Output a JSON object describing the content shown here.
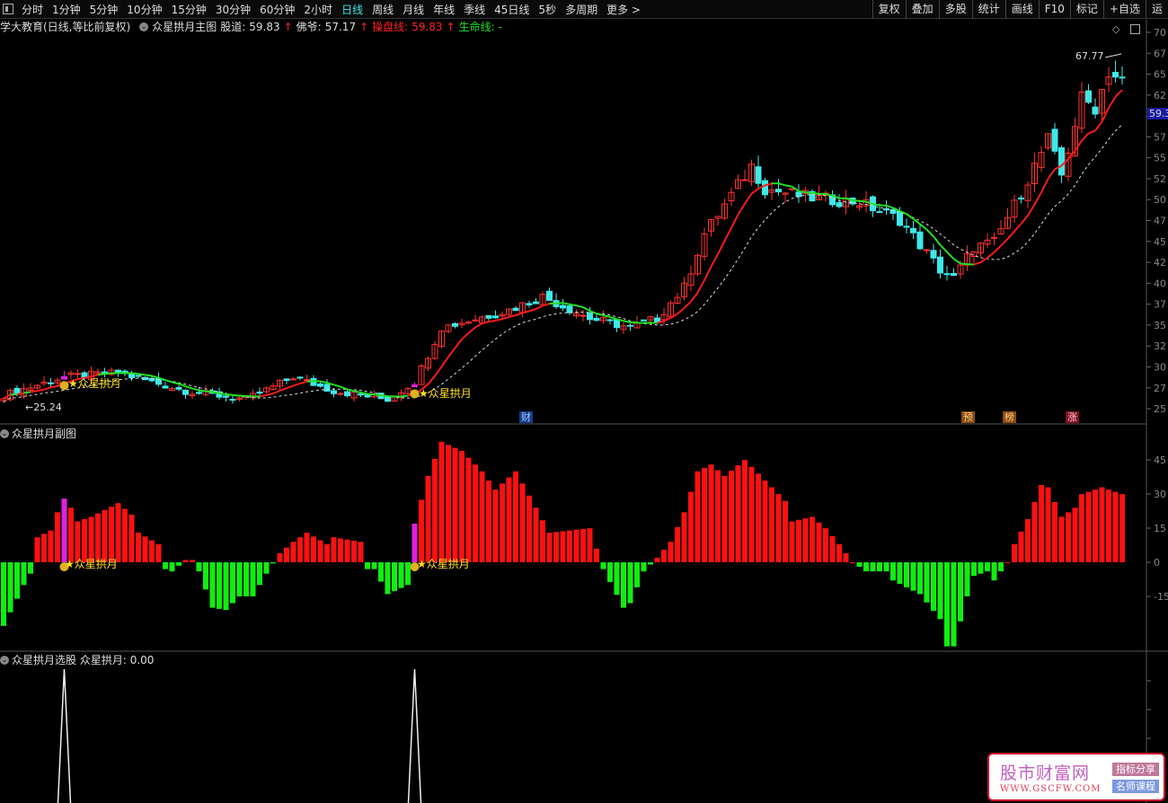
{
  "toolbar": {
    "periods": [
      "分时",
      "1分钟",
      "5分钟",
      "10分钟",
      "15分钟",
      "30分钟",
      "60分钟",
      "2小时",
      "日线",
      "周线",
      "月线",
      "年线",
      "季线",
      "45日线",
      "5秒",
      "多周期",
      "更多 >"
    ],
    "active": "日线",
    "right": [
      "复权",
      "叠加",
      "多股",
      "统计",
      "画线",
      "F10",
      "标记",
      "+自选",
      "运"
    ]
  },
  "header": {
    "stock": "学大教育(日线,等比前复权)",
    "indicator": "众星拱月主图",
    "gudao_label": "股道:",
    "gudao": "59.83",
    "foye_label": "佛爷:",
    "foye": "57.17",
    "caopan_label": "操盘线:",
    "caopan": "59.83",
    "shengming_label": "生命线:",
    "shengming": "-"
  },
  "main": {
    "axis": [
      "70",
      "67",
      "65",
      "62",
      "",
      "57",
      "55",
      "52",
      "50",
      "47",
      "45",
      "42",
      "40",
      "37",
      "35",
      "32",
      "30",
      "27",
      "25"
    ],
    "current_price": "59.3",
    "high_label": "67.77",
    "low_label": "←25.24",
    "signal_label": "★众星拱月",
    "badges": [
      "财",
      "预",
      "榜",
      "涨"
    ],
    "colors": {
      "up": "#ff3030",
      "down": "#3ee8e8",
      "ma_up": "#ff1a1a",
      "ma_flat": "#20e020",
      "signal": "#e020e0"
    },
    "price_keypoints": [
      [
        0,
        26.6
      ],
      [
        9,
        28.8
      ],
      [
        17,
        29.3
      ],
      [
        27,
        27.1
      ],
      [
        36,
        26.1
      ],
      [
        43,
        28.8
      ],
      [
        49,
        27.1
      ],
      [
        57,
        26.1
      ],
      [
        61,
        28.2
      ],
      [
        65,
        34.7
      ],
      [
        75,
        36.8
      ],
      [
        80,
        38.4
      ],
      [
        87,
        35.8
      ],
      [
        93,
        34.7
      ],
      [
        97,
        35.8
      ],
      [
        101,
        39.5
      ],
      [
        104,
        45.9
      ],
      [
        111,
        54.0
      ],
      [
        113,
        51.3
      ],
      [
        120,
        50.2
      ],
      [
        127,
        49.7
      ],
      [
        133,
        47.6
      ],
      [
        139,
        41.6
      ],
      [
        141,
        40.6
      ],
      [
        144,
        44.3
      ],
      [
        147,
        44.9
      ],
      [
        151,
        50.8
      ],
      [
        155,
        57.2
      ],
      [
        157,
        52.9
      ],
      [
        160,
        62.1
      ],
      [
        162,
        61.0
      ],
      [
        164,
        65.3
      ],
      [
        166,
        64.2
      ]
    ],
    "signal_bars": [
      9,
      61
    ]
  },
  "sub": {
    "title": "众星拱月副图",
    "axis": [
      "45",
      "30",
      "15",
      "0",
      "-15"
    ],
    "signal_label": "★众星拱月",
    "hist_keypoints": [
      [
        0,
        -28
      ],
      [
        1,
        -22
      ],
      [
        3,
        -10
      ],
      [
        4,
        -5
      ],
      [
        5,
        11
      ],
      [
        7,
        14
      ],
      [
        8,
        22
      ],
      [
        9,
        28
      ],
      [
        10,
        24
      ],
      [
        11,
        18
      ],
      [
        13,
        20
      ],
      [
        17,
        26
      ],
      [
        19,
        21
      ],
      [
        20,
        13
      ],
      [
        23,
        8
      ],
      [
        24,
        -3
      ],
      [
        25,
        -4
      ],
      [
        27,
        1
      ],
      [
        28,
        1
      ],
      [
        29,
        -4
      ],
      [
        31,
        -20
      ],
      [
        33,
        -21
      ],
      [
        35,
        -15
      ],
      [
        37,
        -15
      ],
      [
        39,
        -5
      ],
      [
        41,
        4
      ],
      [
        43,
        9
      ],
      [
        45,
        13
      ],
      [
        48,
        8
      ],
      [
        49,
        11
      ],
      [
        53,
        9
      ],
      [
        54,
        -3
      ],
      [
        55,
        -3
      ],
      [
        57,
        -14
      ],
      [
        60,
        -10
      ],
      [
        61,
        17
      ],
      [
        63,
        38
      ],
      [
        65,
        53
      ],
      [
        68,
        49
      ],
      [
        71,
        40
      ],
      [
        73,
        32
      ],
      [
        76,
        40
      ],
      [
        79,
        24
      ],
      [
        81,
        13
      ],
      [
        84,
        14
      ],
      [
        87,
        15
      ],
      [
        89,
        -3
      ],
      [
        92,
        -20
      ],
      [
        93,
        -18
      ],
      [
        95,
        -4
      ],
      [
        97,
        2
      ],
      [
        99,
        9
      ],
      [
        101,
        22
      ],
      [
        103,
        40
      ],
      [
        105,
        43
      ],
      [
        107,
        38
      ],
      [
        110,
        45
      ],
      [
        113,
        36
      ],
      [
        116,
        27
      ],
      [
        117,
        18
      ],
      [
        120,
        20
      ],
      [
        122,
        15
      ],
      [
        124,
        8
      ],
      [
        126,
        0
      ],
      [
        128,
        -4
      ],
      [
        131,
        -4
      ],
      [
        132,
        -8
      ],
      [
        136,
        -14
      ],
      [
        139,
        -25
      ],
      [
        140,
        -37
      ],
      [
        141,
        -37
      ],
      [
        143,
        -15
      ],
      [
        144,
        -6
      ],
      [
        146,
        -4
      ],
      [
        147,
        -8
      ],
      [
        149,
        0
      ],
      [
        150,
        8
      ],
      [
        152,
        19
      ],
      [
        154,
        34
      ],
      [
        155,
        33
      ],
      [
        157,
        20
      ],
      [
        159,
        24
      ],
      [
        160,
        30
      ],
      [
        163,
        33
      ],
      [
        166,
        30
      ]
    ]
  },
  "bottom": {
    "title": "众星拱月选股",
    "value_label": "众星拱月:",
    "value": "0.00"
  },
  "watermark": {
    "name": "股市财富网",
    "url": "WWW.GSCFW.COM",
    "tag1": "指标分享",
    "tag2": "名师课程"
  }
}
